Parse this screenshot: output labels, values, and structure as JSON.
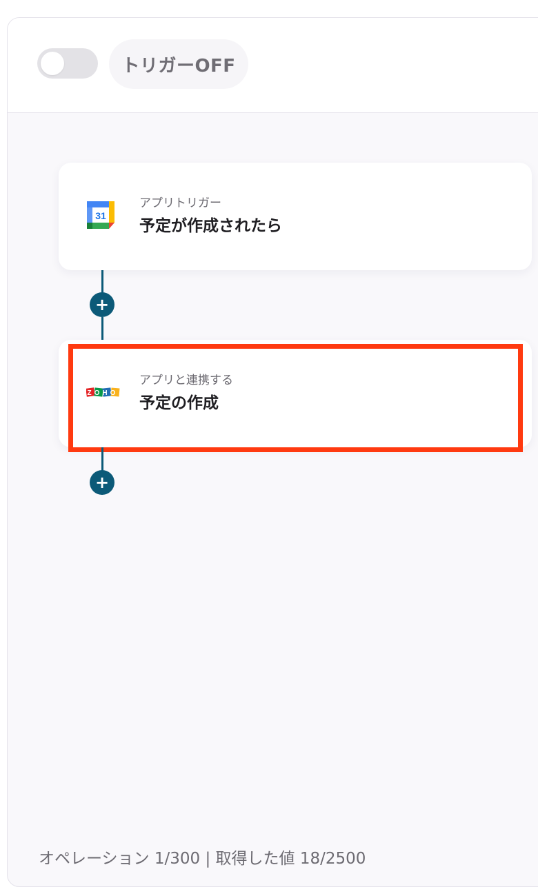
{
  "header": {
    "trigger_toggle_state": "off",
    "trigger_label": "トリガーOFF"
  },
  "flow": {
    "steps": [
      {
        "icon": "google-calendar-icon",
        "icon_text": "31",
        "subtitle": "アプリトリガー",
        "title": "予定が作成されたら"
      },
      {
        "icon": "zoho-icon",
        "icon_text": "ZOHO",
        "subtitle": "アプリと連携する",
        "title": "予定の作成"
      }
    ],
    "add_step_symbol": "+"
  },
  "footer": {
    "status": "オペレーション 1/300 | 取得した値 18/2500"
  },
  "colors": {
    "accent": "#0c5a78",
    "highlight": "#ff3a10"
  }
}
